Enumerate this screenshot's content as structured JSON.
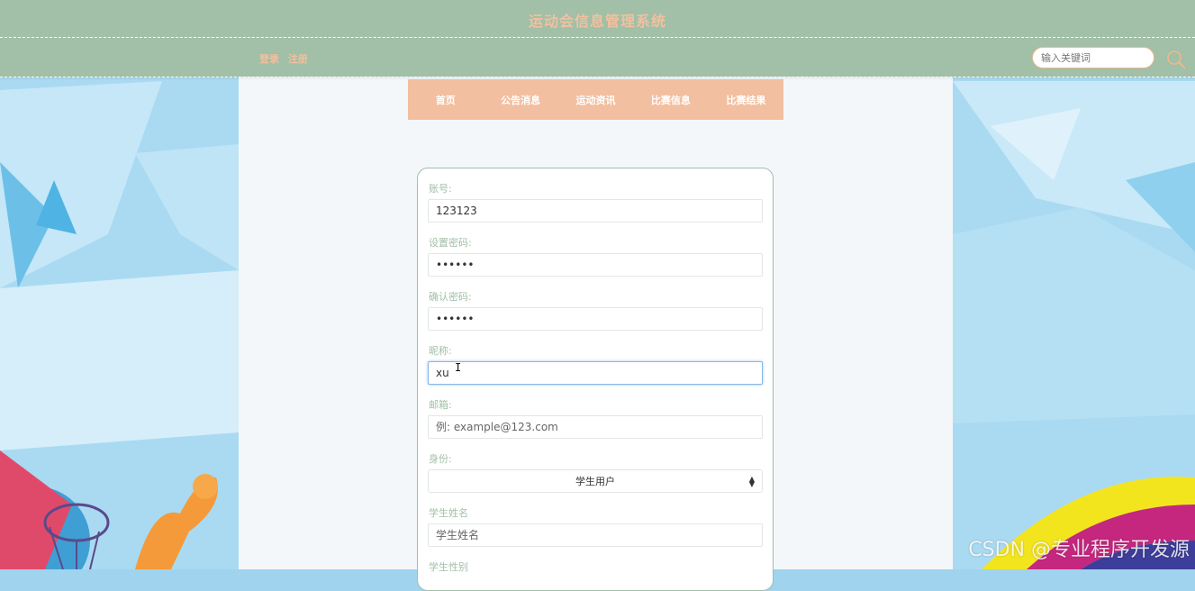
{
  "header": {
    "site_title": "运动会信息管理系统",
    "login_label": "登录",
    "register_label": "注册",
    "search_placeholder": "输入关键词",
    "search_icon": "search-icon"
  },
  "nav": {
    "items": [
      "首页",
      "公告消息",
      "运动资讯",
      "比赛信息",
      "比赛结果"
    ]
  },
  "form": {
    "account": {
      "label": "账号:",
      "value": "123123"
    },
    "password": {
      "label": "设置密码:",
      "value": "••••••"
    },
    "confirm_password": {
      "label": "确认密码:",
      "value": "••••••"
    },
    "nickname": {
      "label": "昵称:",
      "value": "xu"
    },
    "email": {
      "label": "邮箱:",
      "value": "",
      "placeholder": "例: example@123.com"
    },
    "role": {
      "label": "身份:",
      "value": "学生用户"
    },
    "student_name": {
      "label": "学生姓名",
      "value": "",
      "placeholder": "学生姓名"
    },
    "student_gender": {
      "label": "学生性别"
    }
  },
  "watermark": "CSDN @专业程序开发源",
  "colors": {
    "header_bg": "#a2bfa7",
    "accent_peach": "#f2bfa0",
    "title_text": "#f1c1a0",
    "label_green": "#a2bfa7",
    "page_bg": "#9fd3ee"
  }
}
